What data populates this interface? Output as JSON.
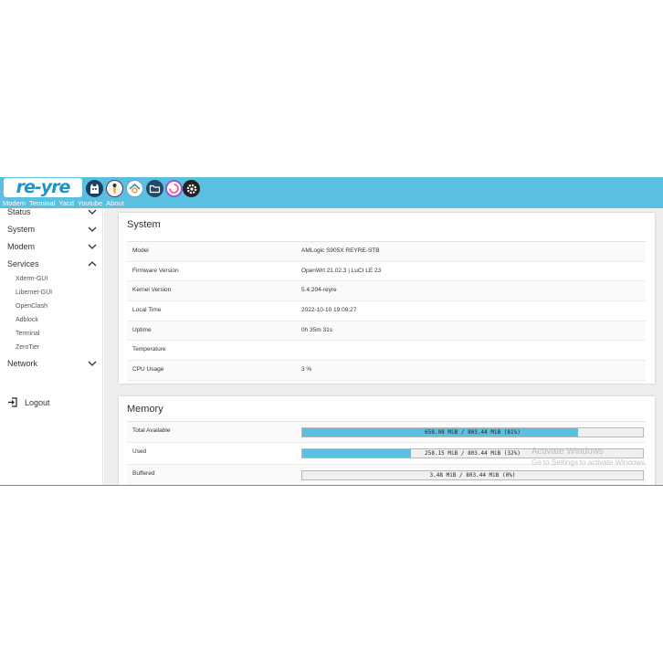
{
  "header": {
    "logo_text": "re-yre",
    "app_icons": [
      {
        "name": "cat-icon"
      },
      {
        "name": "yacd-icon"
      },
      {
        "name": "openclash-icon"
      },
      {
        "name": "folder-icon"
      },
      {
        "name": "speedtest-icon"
      },
      {
        "name": "settings-gear-icon"
      }
    ],
    "nav": [
      "Modem",
      "Terminal",
      "Yacd",
      "Youtube",
      "About"
    ],
    "color": "#5bbfe0"
  },
  "sidebar": {
    "items": [
      {
        "label": "Status",
        "expanded": false
      },
      {
        "label": "System",
        "expanded": false
      },
      {
        "label": "Modem",
        "expanded": false
      },
      {
        "label": "Services",
        "expanded": true
      },
      {
        "label": "Network",
        "expanded": false
      }
    ],
    "services_subitems": [
      "Xderm-GUI",
      "Libernet-GUI",
      "OpenClash",
      "Adblock",
      "Terminal",
      "ZeroTier"
    ],
    "logout_label": "Logout"
  },
  "system": {
    "title": "System",
    "rows": [
      {
        "label": "Model",
        "value": "AMLogic S905X REYRE-STB"
      },
      {
        "label": "Firmware Version",
        "value": "OpenWrt 21.02.3 | LuCI LE 23"
      },
      {
        "label": "Kernel Version",
        "value": "5.4.204-reyre"
      },
      {
        "label": "Local Time",
        "value": "2022-10-10 19:09:27"
      },
      {
        "label": "Uptime",
        "value": "0h 35m 31s"
      },
      {
        "label": "Temperature",
        "value": ""
      },
      {
        "label": "CPU Usage",
        "value": "3 %"
      }
    ]
  },
  "memory": {
    "title": "Memory",
    "rows": [
      {
        "label": "Total Available",
        "text": "658.08 MiB / 803.44 MiB (81%)",
        "percent": 81
      },
      {
        "label": "Used",
        "text": "258.15 MiB / 803.44 MiB (32%)",
        "percent": 32
      },
      {
        "label": "Buffered",
        "text": "3.48 MiB / 803.44 MiB (0%)",
        "percent": 0
      }
    ]
  },
  "watermark": {
    "line1": "Activate Windows",
    "line2": "Go to Settings to activate Windows."
  }
}
